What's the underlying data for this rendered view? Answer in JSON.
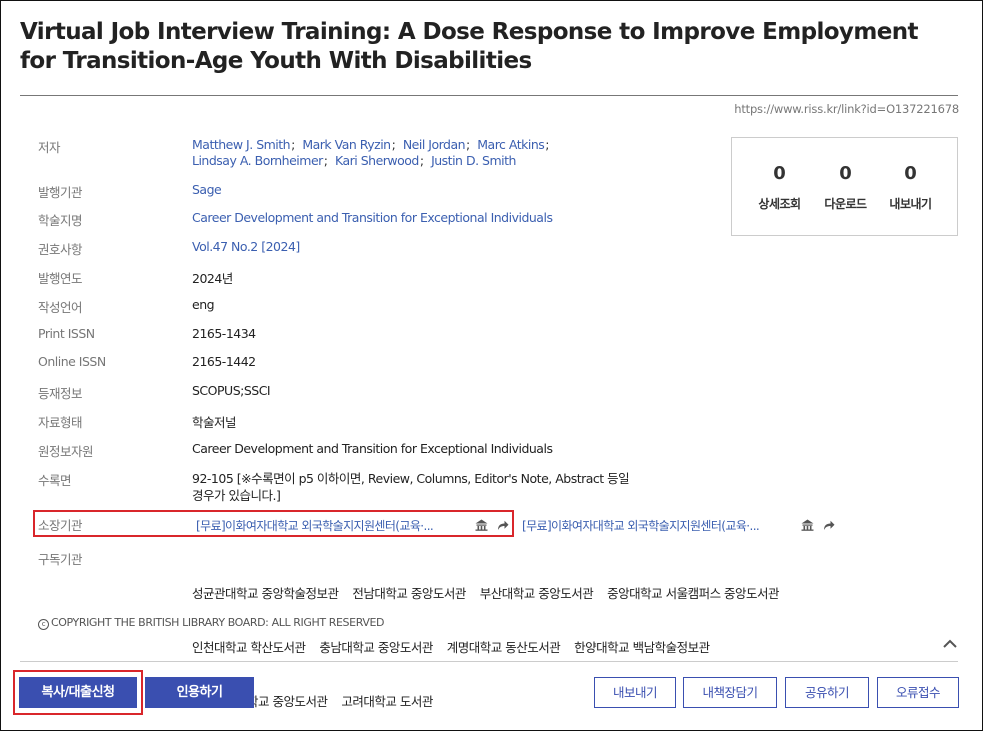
{
  "title": "Virtual Job Interview Training: A Dose Response to Improve Employment for Transition-Age Youth With Disabilities",
  "url": "https://www.riss.kr/link?id=O137221678",
  "stats": [
    {
      "count": "0",
      "label": "상세조회"
    },
    {
      "count": "0",
      "label": "다운로드"
    },
    {
      "count": "0",
      "label": "내보내기"
    }
  ],
  "fields": {
    "author_label": "저자",
    "authors": [
      "Matthew J. Smith",
      "Mark Van Ryzin",
      "Neil Jordan",
      "Marc Atkins",
      "Lindsay A. Bornheimer",
      "Kari Sherwood",
      "Justin D. Smith"
    ],
    "publisher_label": "발행기관",
    "publisher": "Sage",
    "journal_label": "학술지명",
    "journal": "Career Development and Transition for Exceptional Individuals",
    "volume_label": "권호사항",
    "volume": "Vol.47 No.2 [2024]",
    "year_label": "발행연도",
    "year": "2024년",
    "language_label": "작성언어",
    "language": "eng",
    "print_issn_label": "Print ISSN",
    "print_issn": "2165-1434",
    "online_issn_label": "Online ISSN",
    "online_issn": "2165-1442",
    "indexing_label": "등재정보",
    "indexing": "SCOPUS;SSCI",
    "type_label": "자료형태",
    "type": "학술저널",
    "source_label": "원정보자원",
    "source": "Career Development and Transition for Exceptional Individuals",
    "pages_label": "수록면",
    "pages_line1": "92-105   [※수록면이 p5 이하이면, Review, Columns, Editor's Note, Abstract 등일",
    "pages_line2": "경우가 있습니다.]",
    "holdings_label": "소장기관",
    "holdings": [
      "[무료]이화여자대학교 외국학술지지원센터(교육·...",
      "[무료]이화여자대학교 외국학술지지원센터(교육·..."
    ],
    "subscribers_label": "구독기관",
    "subscribers_line1": "성균관대학교 중앙학술정보관    전남대학교 중앙도서관    부산대학교 중앙도서관    중앙대학교 서울캠퍼스 중앙도서관",
    "subscribers_line2": "인천대학교 학산도서관    충남대학교 중앙도서관    계명대학교 동산도서관    한양대학교 백남학술정보관",
    "subscribers_line3": "이화여자대학교 중앙도서관    고려대학교 도서관"
  },
  "copyright": "COPYRIGHT THE BRITISH LIBRARY BOARD: ALL RIGHT RESERVED",
  "buttons": {
    "copy_loan": "복사/대출신청",
    "cite": "인용하기",
    "export": "내보내기",
    "bookshelf": "내책장담기",
    "share": "공유하기",
    "report_error": "오류접수"
  },
  "colors": {
    "accent": "#3a4fb0",
    "link": "#3b5fb0",
    "highlight": "#d9262b"
  }
}
